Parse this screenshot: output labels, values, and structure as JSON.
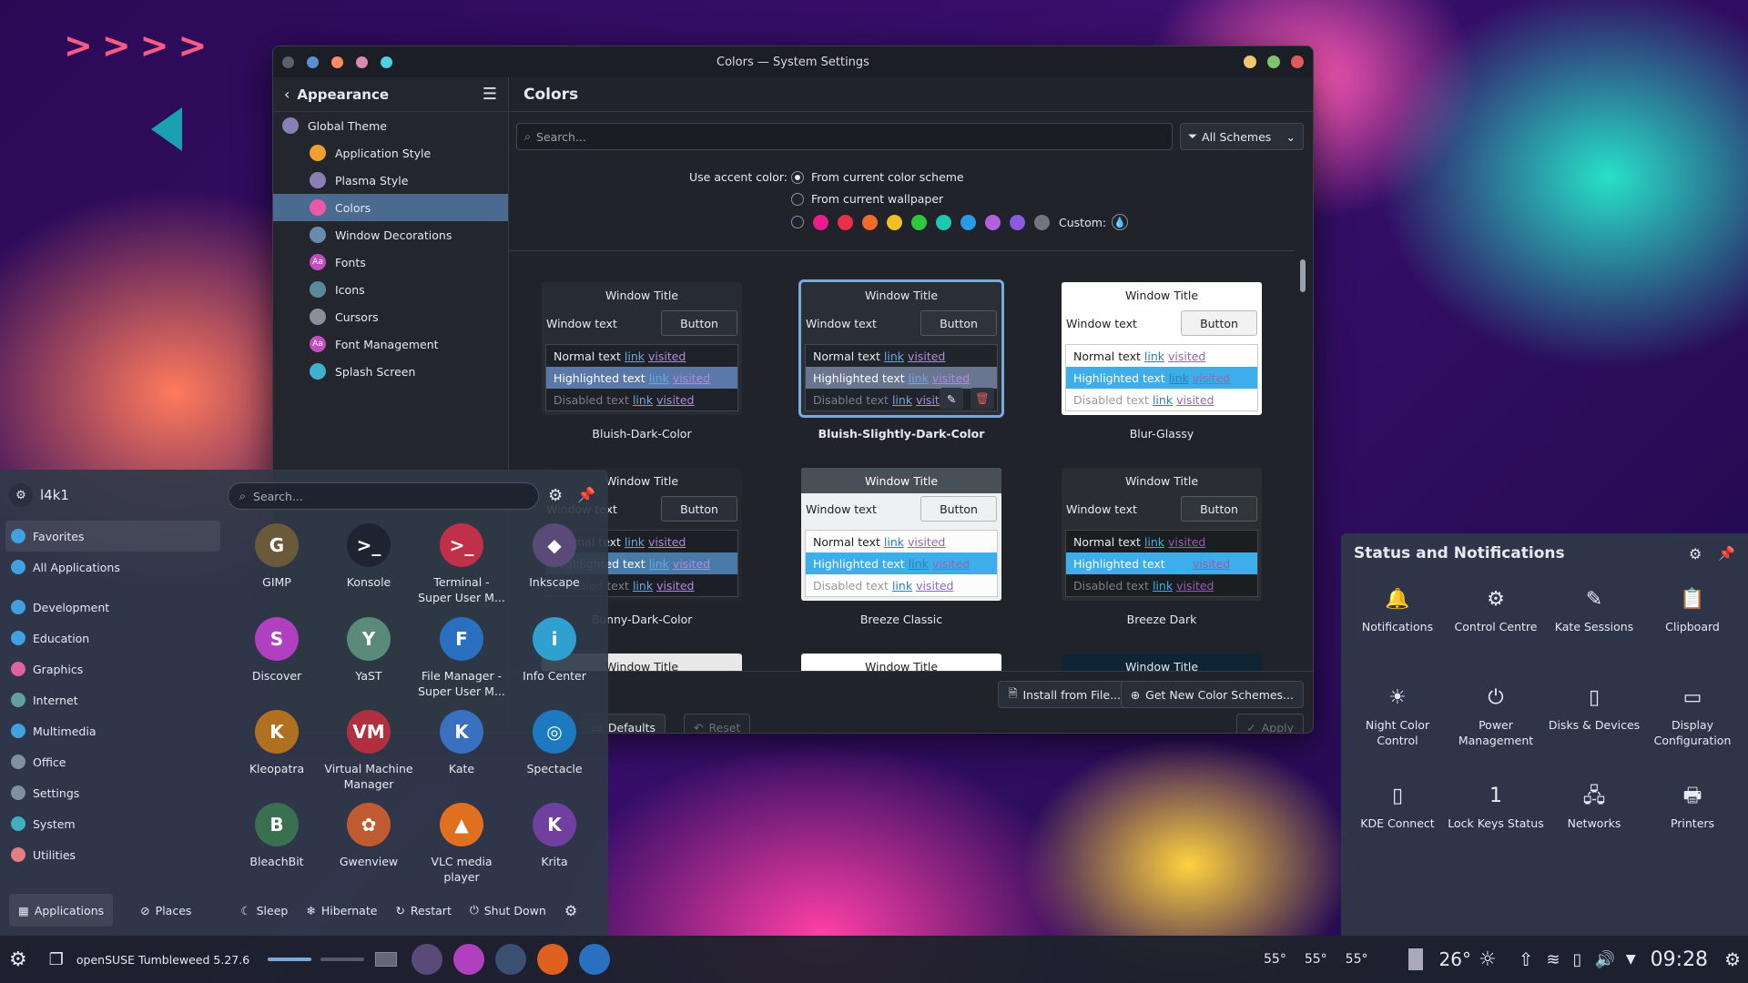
{
  "window": {
    "title": "Colors — System Settings",
    "dots": [
      "#5a8fd0",
      "#ff8a65",
      "#d88ab0",
      "#4dd0e1"
    ],
    "controls": [
      "#f0c674",
      "#7ec46d",
      "#e05c5c"
    ]
  },
  "sidebar": {
    "header": "Appearance",
    "items": [
      {
        "label": "Global Theme",
        "icon": "global-theme-icon",
        "color": "#8a7fb5",
        "top": true
      },
      {
        "label": "Application Style",
        "icon": "application-style-icon",
        "color": "#f0a030"
      },
      {
        "label": "Plasma Style",
        "icon": "plasma-style-icon",
        "color": "#8a7fb5"
      },
      {
        "label": "Colors",
        "icon": "colors-icon",
        "color": "#e85aa8",
        "selected": true
      },
      {
        "label": "Window Decorations",
        "icon": "window-decorations-icon",
        "color": "#6a8ab0"
      },
      {
        "label": "Fonts",
        "icon": "fonts-icon",
        "color": "#c050c0",
        "glyph": "Aa"
      },
      {
        "label": "Icons",
        "icon": "icons-icon",
        "color": "#5a8a9a"
      },
      {
        "label": "Cursors",
        "icon": "cursors-icon",
        "color": "#8a8f99"
      },
      {
        "label": "Font Management",
        "icon": "font-management-icon",
        "color": "#c050c0",
        "glyph": "Aa"
      },
      {
        "label": "Splash Screen",
        "icon": "splash-screen-icon",
        "color": "#40b0d0"
      }
    ]
  },
  "main": {
    "title": "Colors",
    "search_placeholder": "Search...",
    "filter": "All Schemes",
    "accent_label": "Use accent color:",
    "accent_opt1": "From current color scheme",
    "accent_opt2": "From current wallpaper",
    "custom_label": "Custom:",
    "swatches": [
      "#e91e8c",
      "#e9304a",
      "#f06a28",
      "#f0c020",
      "#2ec840",
      "#1ec8b0",
      "#2a9ae8",
      "#b060e0",
      "#8a5ae0",
      "#707580"
    ]
  },
  "schemes": [
    {
      "name": "Bluish-Dark-Color",
      "title": "Window Title",
      "window_text": "Window text",
      "button": "Button",
      "normal": "Normal text",
      "link": "link",
      "visited": "visited",
      "highlighted": "Highlighted text",
      "disabled": "Disabled text",
      "bg": "#272b33",
      "wt_bg": "#272b33",
      "fg": "#e6e9ef",
      "btn_bg": "#2a2f38",
      "view_bg": "#1e2128",
      "hl_bg": "#5a78a8",
      "link_c": "#6aa8e0",
      "vis_c": "#b08ae0",
      "dis_c": "#7a808a"
    },
    {
      "name": "Bluish-Slightly-Dark-Color",
      "title": "Window Title",
      "window_text": "Window text",
      "button": "Button",
      "normal": "Normal text",
      "link": "link",
      "visited": "visited",
      "highlighted": "Highlighted text",
      "disabled": "Disabled text",
      "bg": "#2a2e36",
      "wt_bg": "#2a2e36",
      "fg": "#e6e9ef",
      "btn_bg": "#2e333c",
      "view_bg": "#20242b",
      "hl_bg": "#6a7690",
      "link_c": "#6aa8e0",
      "vis_c": "#b08ae0",
      "dis_c": "#7a808a"
    },
    {
      "name": "Blur-Glassy",
      "title": "Window Title",
      "window_text": "Window text",
      "button": "Button",
      "normal": "Normal text",
      "link": "link",
      "visited": "visited",
      "highlighted": "Highlighted text",
      "disabled": "Disabled text",
      "bg": "#ffffff",
      "wt_bg": "#ffffff",
      "fg": "#222222",
      "btn_bg": "#f2f2f2",
      "view_bg": "#ffffff",
      "hl_bg": "#3daee9",
      "link_c": "#2980b9",
      "vis_c": "#8e6ab8",
      "dis_c": "#9a9a9a"
    },
    {
      "name": "Bunny-Dark-Color",
      "title": "Window Title",
      "window_text": "Window text",
      "button": "Button",
      "normal": "Normal text",
      "link": "link",
      "visited": "visited",
      "highlighted": "Highlighted text",
      "disabled": "Disabled text",
      "bg": "#24272e",
      "wt_bg": "#24272e",
      "fg": "#e6e9ef",
      "btn_bg": "#2a2f38",
      "view_bg": "#1c1f25",
      "hl_bg": "#4a7aa8",
      "link_c": "#6aa8e0",
      "vis_c": "#b08ae0",
      "dis_c": "#7a808a"
    },
    {
      "name": "Breeze Classic",
      "title": "Window Title",
      "window_text": "Window text",
      "button": "Button",
      "normal": "Normal text",
      "link": "link",
      "visited": "visited",
      "highlighted": "Highlighted text",
      "disabled": "Disabled text",
      "bg": "#eff0f1",
      "wt_bg": "#475057",
      "fg": "#222222",
      "btn_bg": "#eff0f1",
      "view_bg": "#fcfcfc",
      "hl_bg": "#3daee9",
      "link_c": "#2980b9",
      "vis_c": "#8e6ab8",
      "dis_c": "#9a9a9a"
    },
    {
      "name": "Breeze Dark",
      "title": "Window Title",
      "window_text": "Window text",
      "button": "Button",
      "normal": "Normal text",
      "link": "link",
      "visited": "visited",
      "highlighted": "Highlighted text",
      "disabled": "Disabled text",
      "bg": "#2a2e32",
      "wt_bg": "#2a2e32",
      "fg": "#e6e9ef",
      "btn_bg": "#31363b",
      "view_bg": "#1b1e20",
      "hl_bg": "#3daee9",
      "link_c": "#3daee9",
      "vis_c": "#9b59b6",
      "dis_c": "#7a808a"
    }
  ],
  "partial_row": [
    {
      "title": "Window Title",
      "wt_bg": "#e8e8e8",
      "fg": "#222222"
    },
    {
      "title": "Window Title",
      "wt_bg": "#ffffff",
      "fg": "#222222"
    },
    {
      "title": "Window Title",
      "wt_bg": "#0f2535",
      "fg": "#e6e9ef"
    }
  ],
  "bottom": {
    "install": "Install from File...",
    "getnew": "Get New Color Schemes...",
    "defaults": "Defaults",
    "reset": "Reset",
    "apply": "Apply"
  },
  "launcher": {
    "user": "l4k1",
    "search_placeholder": "Search...",
    "categories": [
      {
        "label": "Favorites",
        "color": "#40a0e0"
      },
      {
        "label": "All Applications",
        "color": "#40a0e0"
      },
      {
        "label": "Development",
        "color": "#40a0e0"
      },
      {
        "label": "Education",
        "color": "#40a0e0"
      },
      {
        "label": "Graphics",
        "color": "#e060a0"
      },
      {
        "label": "Internet",
        "color": "#60a0a0"
      },
      {
        "label": "Multimedia",
        "color": "#40a0e0"
      },
      {
        "label": "Office",
        "color": "#8090a0"
      },
      {
        "label": "Settings",
        "color": "#8090a0"
      },
      {
        "label": "System",
        "color": "#40b0c0"
      },
      {
        "label": "Utilities",
        "color": "#e08080"
      }
    ],
    "apps": [
      {
        "label": "GIMP",
        "color": "#6a5a3a",
        "glyph": "G"
      },
      {
        "label": "Konsole",
        "color": "#1e2530",
        "glyph": ">_"
      },
      {
        "label": "Terminal - Super User M...",
        "color": "#c03048",
        "glyph": ">_"
      },
      {
        "label": "Inkscape",
        "color": "#5a4a7a",
        "glyph": "◆"
      },
      {
        "label": "Discover",
        "color": "#b040c0",
        "glyph": "S"
      },
      {
        "label": "YaST",
        "color": "#5a8a7a",
        "glyph": "Y"
      },
      {
        "label": "File Manager - Super User M...",
        "color": "#2a70c0",
        "glyph": "F"
      },
      {
        "label": "Info Center",
        "color": "#30a0d0",
        "glyph": "i"
      },
      {
        "label": "Kleopatra",
        "color": "#b07020",
        "glyph": "K"
      },
      {
        "label": "Virtual Machine Manager",
        "color": "#b03040",
        "glyph": "VM"
      },
      {
        "label": "Kate",
        "color": "#3a70c0",
        "glyph": "K"
      },
      {
        "label": "Spectacle",
        "color": "#1e7ac0",
        "glyph": "◎"
      },
      {
        "label": "BleachBit",
        "color": "#3a7050",
        "glyph": "B"
      },
      {
        "label": "Gwenview",
        "color": "#c05a30",
        "glyph": "✿"
      },
      {
        "label": "VLC media player",
        "color": "#e07020",
        "glyph": "▲"
      },
      {
        "label": "Krita",
        "color": "#7040a0",
        "glyph": "K"
      }
    ],
    "footer": {
      "applications": "Applications",
      "places": "Places",
      "sleep": "Sleep",
      "hibernate": "Hibernate",
      "restart": "Restart",
      "shutdown": "Shut Down"
    }
  },
  "notifications": {
    "title": "Status and Notifications",
    "items": [
      {
        "label": "Notifications",
        "icon": "bell-icon",
        "glyph": "🔔"
      },
      {
        "label": "Control Centre",
        "icon": "gear-icon",
        "glyph": "⚙"
      },
      {
        "label": "Kate Sessions",
        "icon": "kate-sessions-icon",
        "glyph": "✎"
      },
      {
        "label": "Clipboard",
        "icon": "clipboard-icon",
        "glyph": "📋"
      },
      {
        "label": "Night Color Control",
        "icon": "night-color-icon",
        "glyph": "☀"
      },
      {
        "label": "Power Management",
        "icon": "power-management-icon",
        "glyph": "⏻"
      },
      {
        "label": "Disks & Devices",
        "icon": "disks-icon",
        "glyph": "▯"
      },
      {
        "label": "Display Configuration",
        "icon": "display-icon",
        "glyph": "▭"
      },
      {
        "label": "KDE Connect",
        "icon": "kde-connect-icon",
        "glyph": "▯"
      },
      {
        "label": "Lock Keys Status",
        "icon": "lock-keys-icon",
        "glyph": "1"
      },
      {
        "label": "Networks",
        "icon": "network-icon",
        "glyph": "🖧"
      },
      {
        "label": "Printers",
        "icon": "printer-icon",
        "glyph": "🖶"
      }
    ]
  },
  "taskbar": {
    "distro": "openSUSE Tumbleweed 5.27.6",
    "temps": [
      "55°",
      "55°",
      "55°"
    ],
    "weather": "26°",
    "clock": "09:28",
    "apps": [
      {
        "icon": "inkscape-task-icon",
        "color": "#5a4a7a"
      },
      {
        "icon": "discover-task-icon",
        "color": "#b040c0"
      },
      {
        "icon": "settings-task-icon",
        "color": "#3a5070"
      },
      {
        "icon": "firefox-task-icon",
        "color": "#e06020"
      },
      {
        "icon": "dolphin-task-icon",
        "color": "#2a70c0"
      }
    ]
  }
}
